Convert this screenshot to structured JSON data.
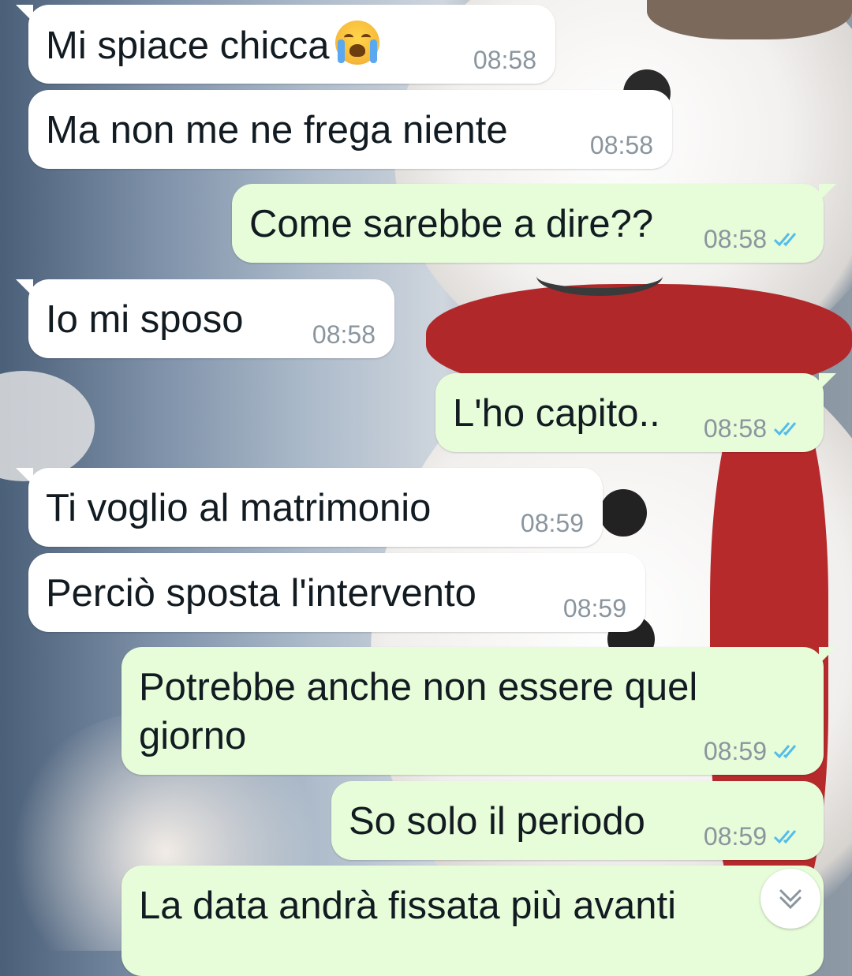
{
  "colors": {
    "incoming_bubble": "#ffffff",
    "outgoing_bubble": "#e7fcd8",
    "read_ticks": "#53bdeb",
    "time_text": "#8a959e"
  },
  "messages": [
    {
      "dir": "in",
      "text": "Mi spiace chicca",
      "emoji": "loudly-crying-face",
      "time": "08:58"
    },
    {
      "dir": "in",
      "text": "Ma non me ne frega niente",
      "time": "08:58"
    },
    {
      "dir": "out",
      "text": "Come sarebbe a dire??",
      "time": "08:58",
      "status": "read"
    },
    {
      "dir": "in",
      "text": "Io mi sposo",
      "time": "08:58"
    },
    {
      "dir": "out",
      "text": "L'ho capito..",
      "time": "08:58",
      "status": "read"
    },
    {
      "dir": "in",
      "text": "Ti voglio al matrimonio",
      "time": "08:59"
    },
    {
      "dir": "in",
      "text": "Perciò sposta l'intervento",
      "time": "08:59"
    },
    {
      "dir": "out",
      "text": "Potrebbe anche non essere quel giorno",
      "time": "08:59",
      "status": "read"
    },
    {
      "dir": "out",
      "text": "So solo il periodo",
      "time": "08:59",
      "status": "read"
    },
    {
      "dir": "out",
      "text": "La data andrà fissata più avanti",
      "status": "read"
    }
  ],
  "scroll_button": {
    "icon": "double-chevron-down-icon"
  }
}
